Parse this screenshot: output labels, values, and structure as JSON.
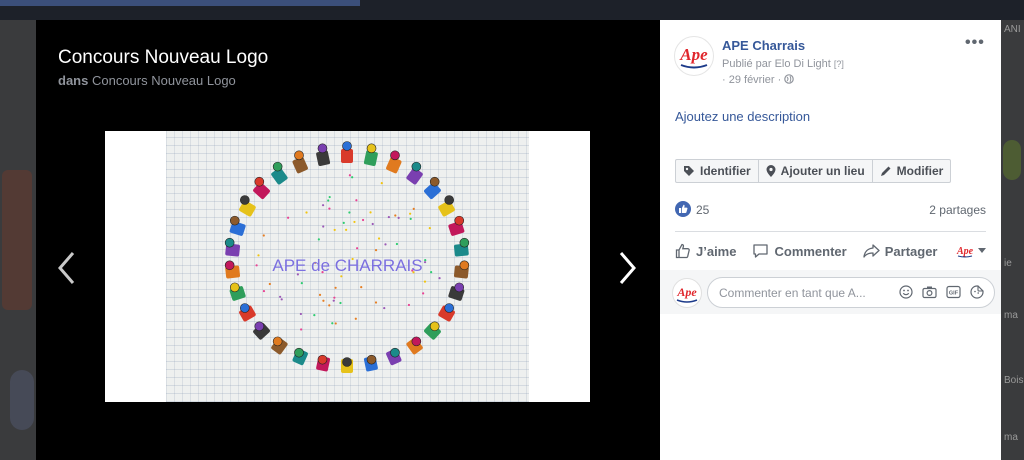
{
  "background": {
    "right_fragments": [
      "ANI",
      "ie",
      "ma",
      "Bois",
      "ma"
    ]
  },
  "viewer": {
    "album_title": "Concours Nouveau Logo",
    "subtitle_prefix": "dans",
    "subtitle_album": "Concours Nouveau Logo",
    "photo_caption": "APE de CHARRAIS",
    "prev_icon": "chevron-left-icon",
    "next_icon": "chevron-right-icon"
  },
  "post": {
    "page_name": "APE Charrais",
    "logo_text": "Ape",
    "published_by": "Publié par Elo Di Light",
    "help_mark": "[?]",
    "date": "· 29 février ·",
    "audience_icon": "globe-icon",
    "more_label": "•••",
    "add_description": "Ajoutez une description",
    "actions": [
      {
        "label": "Identifier",
        "icon": "tag-icon"
      },
      {
        "label": "Ajouter un lieu",
        "icon": "location-pin-icon"
      },
      {
        "label": "Modifier",
        "icon": "pencil-icon"
      }
    ],
    "like_count": "25",
    "shares": "2 partages",
    "social": {
      "like": "J’aime",
      "comment": "Commenter",
      "share": "Partager"
    },
    "comment_placeholder": "Commenter en tant que A...",
    "comment_icons": [
      "emoji-icon",
      "camera-icon",
      "gif-icon",
      "sticker-icon"
    ]
  },
  "colors": {
    "link_blue": "#365899",
    "like_blue": "#4267b2",
    "logo_red": "#e0262c",
    "caption_purple": "#7b6fe0"
  }
}
